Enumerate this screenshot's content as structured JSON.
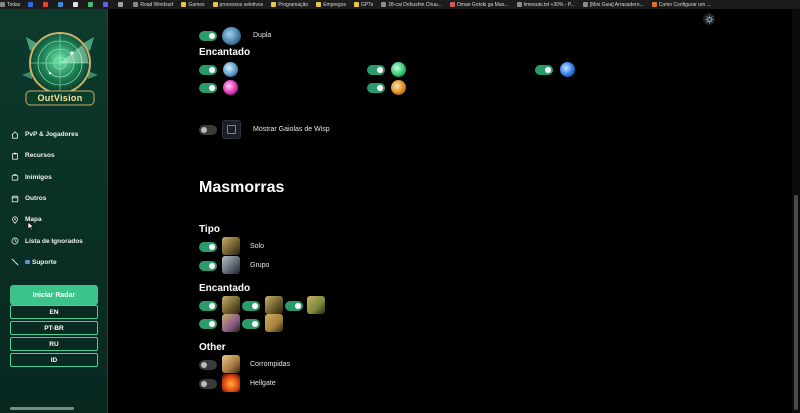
{
  "bookmarks": [
    {
      "label": "Todas",
      "color": "#888888"
    },
    {
      "label": "",
      "color": "#2f6ae0"
    },
    {
      "label": "",
      "color": "#ea4335"
    },
    {
      "label": "",
      "color": "#3a8bd8"
    },
    {
      "label": "",
      "color": "#e0e0e0"
    },
    {
      "label": "",
      "color": "#3ec070"
    },
    {
      "label": "",
      "color": "#5865f2"
    },
    {
      "label": "",
      "color": "#a0a0a0"
    },
    {
      "label": "Road Windsurf",
      "color": "#888888"
    },
    {
      "label": "Games",
      "color": "#e8c64a"
    },
    {
      "label": "processos seletivos",
      "color": "#e8c64a"
    },
    {
      "label": "Programação",
      "color": "#e8c64a"
    },
    {
      "label": "Empregos",
      "color": "#e8c64a"
    },
    {
      "label": "GPTs",
      "color": "#e8c64a"
    },
    {
      "label": "28-cai Dohushin Chuu...",
      "color": "#8c8c8c"
    },
    {
      "label": "Omae Gotoki ga Mao...",
      "color": "#d05a5a"
    },
    {
      "label": "timeouts.txt +30% - P...",
      "color": "#8c8c8c"
    },
    {
      "label": "[Mini Guia] Arrasadero...",
      "color": "#8c8c8c"
    },
    {
      "label": "Como Configurar um ...",
      "color": "#e07030"
    }
  ],
  "sidebar": {
    "logo_text": "OutVision",
    "nav": [
      {
        "label": "PvP & Jogadores",
        "icon": "home-icon"
      },
      {
        "label": "Recursos",
        "icon": "clipboard-icon"
      },
      {
        "label": "Inimigos",
        "icon": "bag-icon"
      },
      {
        "label": "Outros",
        "icon": "box-icon"
      },
      {
        "label": "Mapa",
        "icon": "map-pin-icon"
      },
      {
        "label": "Lista de Ignorados",
        "icon": "block-list-icon"
      },
      {
        "label": "Suporte",
        "icon": "unlink-icon"
      }
    ],
    "start_label": "Iniciar Radar",
    "languages": [
      "EN",
      "PT-BR",
      "RU",
      "ID"
    ]
  },
  "top": {
    "dupla_label": "Dupla",
    "encantado_title": "Encantado",
    "wisp_label": "Mostrar Gaiolas de Wisp"
  },
  "dungeons": {
    "title": "Masmorras",
    "tipo_title": "Tipo",
    "tipo": [
      {
        "label": "Solo",
        "enabled": true
      },
      {
        "label": "Grupo",
        "enabled": true
      }
    ],
    "encantado_title": "Encantado",
    "other_title": "Other",
    "other": [
      {
        "label": "Corrompidas",
        "enabled": false
      },
      {
        "label": "Hellgate",
        "enabled": false
      }
    ]
  },
  "colors": {
    "accent": "#3cc38a",
    "toggle_on": "#2c9b6c",
    "sidebar_bg": "#0d3a2d"
  }
}
